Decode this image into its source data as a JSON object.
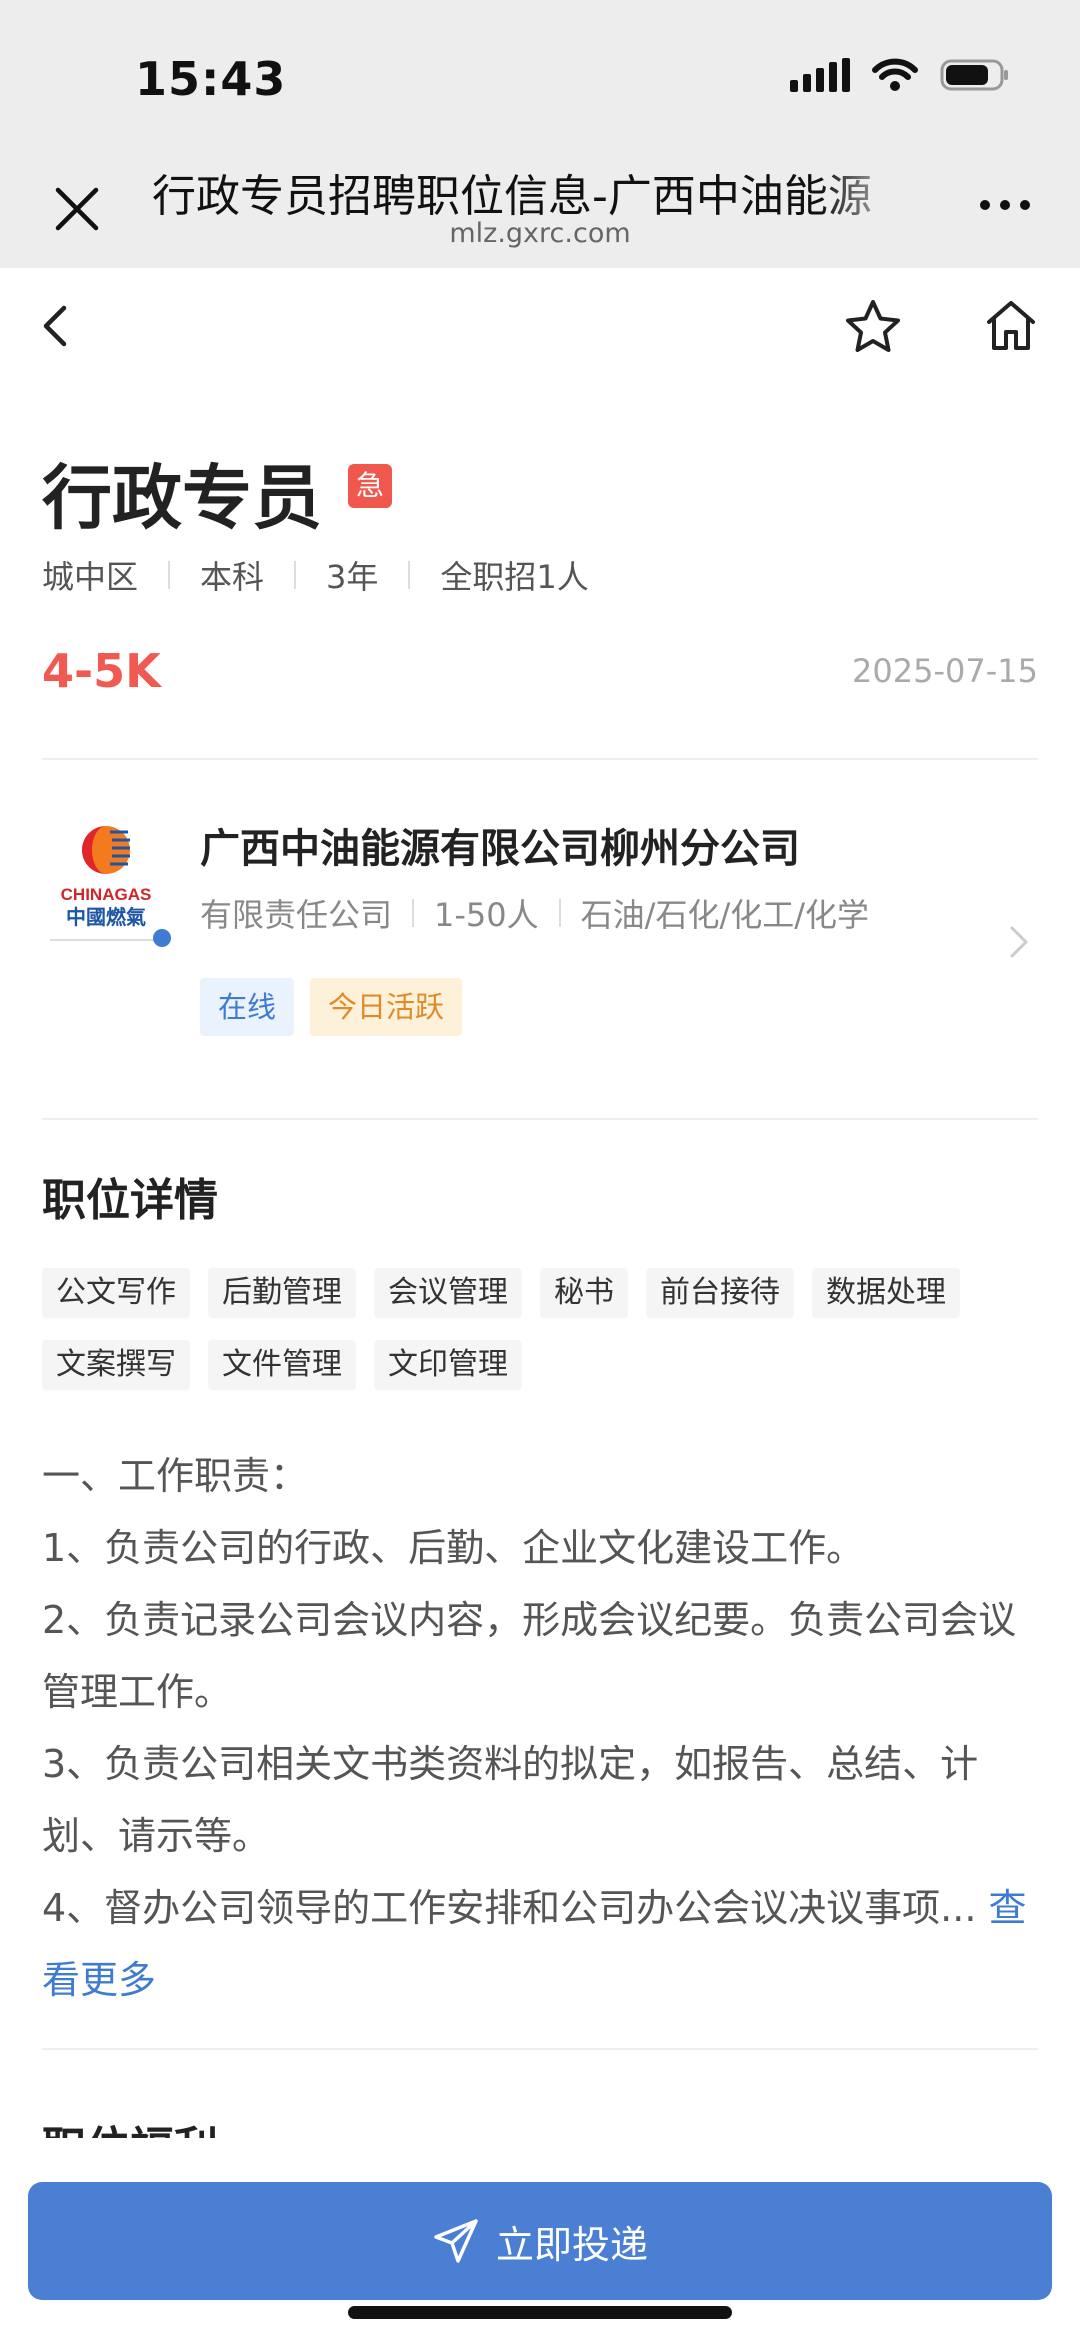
{
  "status_bar": {
    "time": "15:43"
  },
  "browser": {
    "title": "行政专员招聘职位信息-广西中油能源",
    "url": "mlz.gxrc.com"
  },
  "job": {
    "title": "行政专员",
    "urgent_badge": "急",
    "meta": [
      "城中区",
      "本科",
      "3年",
      "全职招1人"
    ],
    "salary": "4-5K",
    "date": "2025-07-15"
  },
  "company": {
    "logo_text_en": "CHINAGAS",
    "logo_text_cn": "中國燃氣",
    "name": "广西中油能源有限公司柳州分公司",
    "meta": [
      "有限责任公司",
      "1-50人",
      "石油/石化/化工/化学"
    ],
    "chips": {
      "online": "在线",
      "active": "今日活跃"
    }
  },
  "details": {
    "title": "职位详情",
    "tags": [
      "公文写作",
      "后勤管理",
      "会议管理",
      "秘书",
      "前台接待",
      "数据处理",
      "文案撰写",
      "文件管理",
      "文印管理"
    ],
    "description": [
      "一、工作职责：",
      "1、负责公司的行政、后勤、企业文化建设工作。",
      "2、负责记录公司会议内容，形成会议纪要。负责公司会议管理工作。",
      "3、负责公司相关文书类资料的拟定，如报告、总结、计划、请示等。",
      "4、督办公司领导的工作安排和公司办公会议决议事项..."
    ],
    "more_label": "查看更多"
  },
  "benefits": {
    "title": "职位福利"
  },
  "apply": {
    "label": "立即投递"
  },
  "colors": {
    "accent": "#4a7fd3",
    "salary": "#f05a50",
    "urgent": "#f0584d"
  }
}
